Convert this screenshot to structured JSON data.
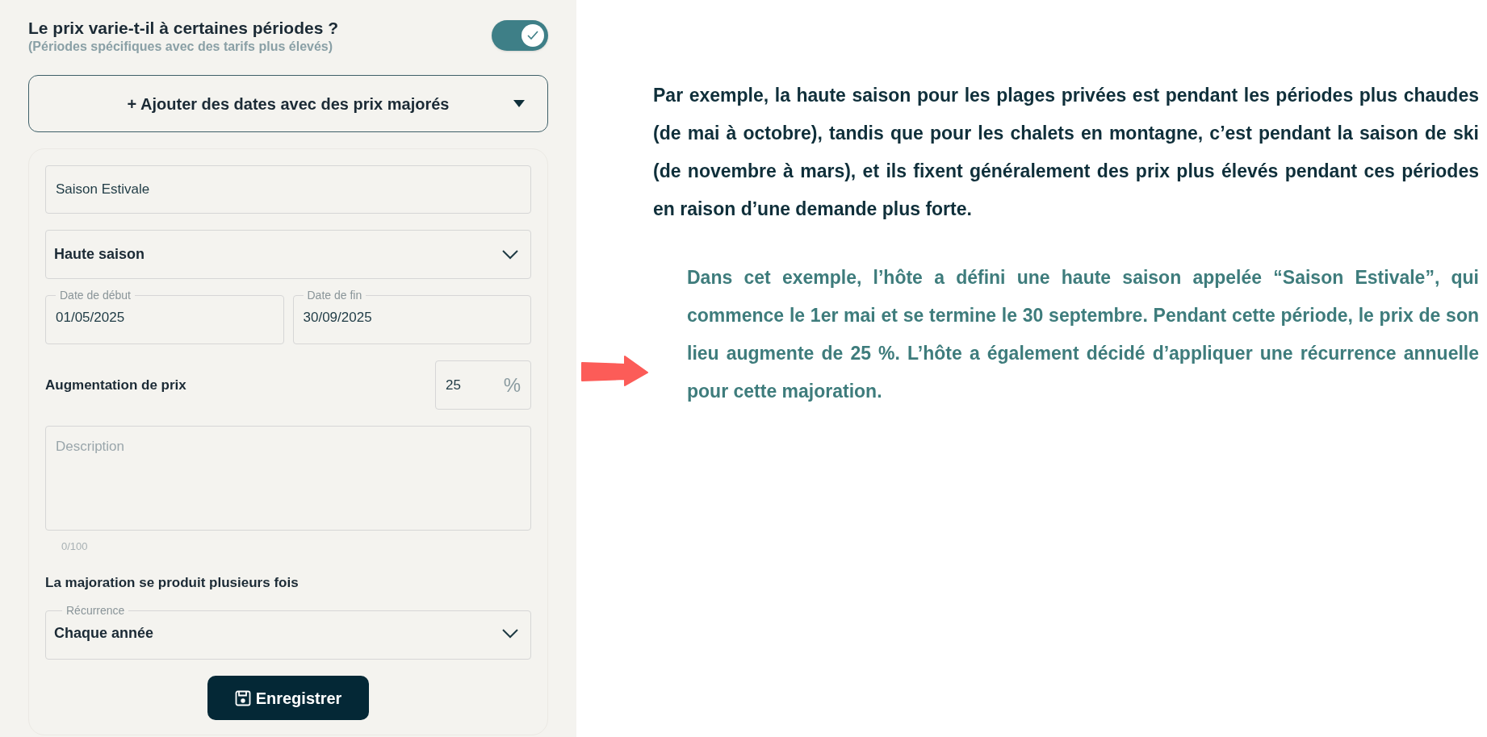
{
  "settings": {
    "title": "Le prix varie-t-il à certaines périodes ?",
    "subtitle": "(Périodes spécifiques avec des tarifs plus élevés)",
    "toggle": {
      "on": true
    },
    "add_button": {
      "label": "+ Ajouter des dates avec des prix majorés",
      "expanded": true
    },
    "form": {
      "name_field": {
        "value": "Saison Estivale"
      },
      "season_select": {
        "value": "Haute saison"
      },
      "dates": [
        {
          "label": "Date de début",
          "value": "01/05/2025"
        },
        {
          "label": "Date de fin",
          "value": "30/09/2025"
        }
      ],
      "increase": {
        "label": "Augmentation de prix",
        "value": "25",
        "unit": "%"
      },
      "description": {
        "placeholder": "Description",
        "counter": "0/100"
      },
      "recurrence_heading": "La majoration se produit plusieurs fois",
      "recurrence": {
        "label": "Récurrence",
        "value": "Chaque année"
      },
      "save_button": "Enregistrer"
    }
  },
  "explanation": {
    "paragraphs": [
      {
        "kind": "main",
        "text": "Par exemple, la haute saison pour les plages privées est pendant les périodes plus chaudes (de mai à octobre), tandis que pour les chalets en montagne, c’est pendant la saison de ski (de novembre à mars), et ils fixent généralement des prix plus élevés pendant ces périodes en raison d’une demande plus forte."
      },
      {
        "kind": "example",
        "text": "Dans cet exemple, l’hôte a défini une haute saison appelée “Saison Estivale”, qui commence le 1er mai et se termine le 30 septembre. Pendant cette période, le prix de son lieu augmente de 25 %. L’hôte a également décidé d’appliquer une récurrence annuelle pour cette majoration."
      }
    ]
  }
}
